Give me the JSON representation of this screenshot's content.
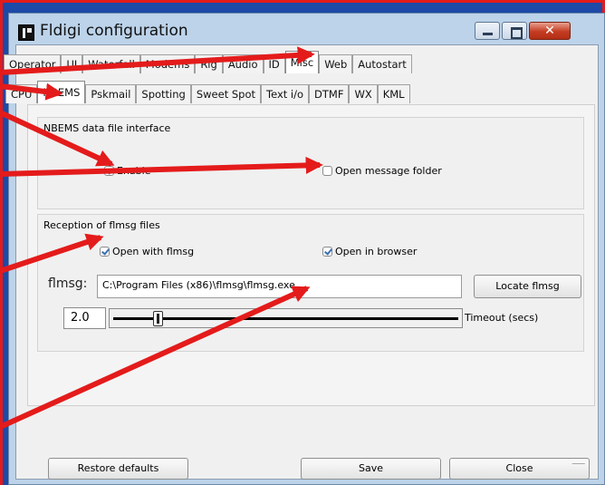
{
  "window": {
    "title": "Fldigi configuration"
  },
  "tabs_row1": [
    "Operator",
    "UI",
    "Waterfall",
    "Modems",
    "Rig",
    "Audio",
    "ID",
    "Misc",
    "Web",
    "Autostart"
  ],
  "tabs_row1_active": "Misc",
  "tabs_row2": [
    "CPU",
    "NBEMS",
    "Pskmail",
    "Spotting",
    "Sweet Spot",
    "Text i/o",
    "DTMF",
    "WX",
    "KML"
  ],
  "tabs_row2_active": "NBEMS",
  "nbems_group": {
    "title": "NBEMS data file interface",
    "enable_label": "Enable",
    "enable_checked": true,
    "open_folder_label": "Open message folder",
    "open_folder_checked": false
  },
  "reception_group": {
    "title": "Reception of flmsg files",
    "open_with_label": "Open with flmsg",
    "open_with_checked": true,
    "open_browser_label": "Open in browser",
    "open_browser_checked": true,
    "flmsg_label": "flmsg:",
    "flmsg_path": "C:\\Program Files (x86)\\flmsg\\flmsg.exe",
    "locate_label": "Locate flmsg",
    "timeout_value": "2.0",
    "timeout_label": "Timeout (secs)",
    "timeout_fraction": 0.12
  },
  "buttons": {
    "restore": "Restore defaults",
    "save": "Save",
    "close": "Close"
  },
  "colors": {
    "annotation_arrow": "#e41b1b",
    "desktop": "#1d49a8",
    "window_frame": "#bcd3ea"
  },
  "icons": [
    "fldigi-app-icon",
    "minimize-icon",
    "maximize-icon",
    "close-icon",
    "resize-grip-icon"
  ]
}
